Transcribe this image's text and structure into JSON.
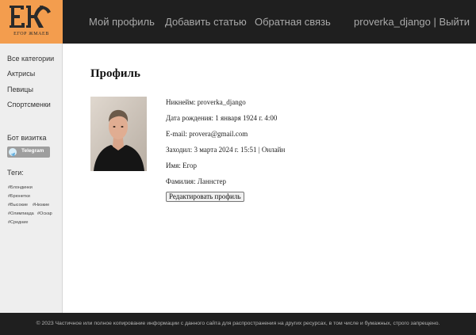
{
  "header": {
    "logo_sub": "ЕГОР ЖМАЕВ",
    "nav": [
      "Мой профиль",
      "Добавить статью",
      "Обратная связь"
    ],
    "username": "proverka_django",
    "separator": " | ",
    "logout": "Выйти"
  },
  "sidebar": {
    "categories": [
      "Все категории",
      "Актрисы",
      "Певицы",
      "Спортсменки"
    ],
    "bot_heading": "Бот визитка",
    "telegram_label": "Telegram",
    "tags_heading": "Теги:",
    "tags": [
      "#Блондинки",
      "#Брюнетки",
      "#Высокие",
      "#Низкие",
      "#Олимпиада",
      "#Оскар",
      "#Средние"
    ]
  },
  "main": {
    "title": "Профиль",
    "nickname": "Никнейм: proverka_django",
    "birthdate": "Дата рождения: 1 января 1924 г. 4:00",
    "email": "E-mail: provera@gmail.com",
    "last_seen": "Заходил: 3 марта 2024 г. 15:51",
    "status_sep": " | ",
    "status": "Онлайн",
    "first_name": "Имя: Егор",
    "last_name": "Фамилия: Ланнстер",
    "edit_button": "Редактировать профиль"
  },
  "footer": {
    "text": "© 2023 Частичное или полное копирование информации с данного сайта для распространения на других ресурсах, в том числе и бумажных, строго запрещено."
  }
}
